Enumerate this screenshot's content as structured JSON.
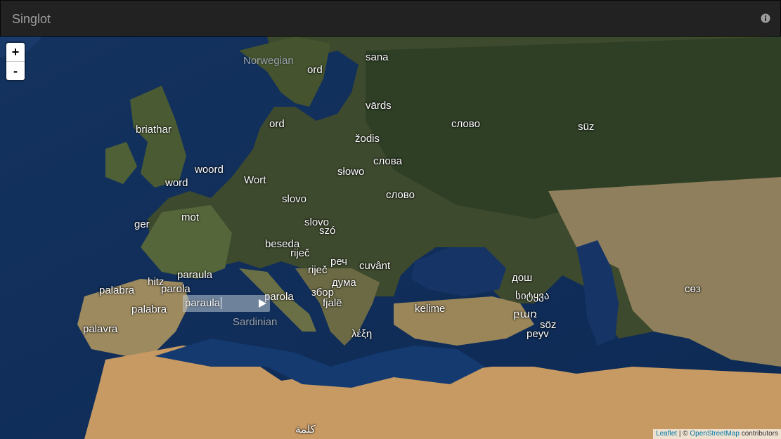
{
  "app": {
    "title": "Singlot",
    "info_icon": "info-circle-icon"
  },
  "zoom": {
    "in_label": "+",
    "out_label": "-"
  },
  "editor": {
    "value": "paraula",
    "submit_icon": "play-icon"
  },
  "region_labels": [
    {
      "key": "norwegian",
      "text": "Norwegian"
    },
    {
      "key": "sardinian",
      "text": "Sardinian"
    }
  ],
  "words": [
    {
      "key": "sana",
      "text": "sana"
    },
    {
      "key": "ord_no",
      "text": "ord"
    },
    {
      "key": "vards",
      "text": "vārds"
    },
    {
      "key": "ord_sv",
      "text": "ord"
    },
    {
      "key": "zodis",
      "text": "žodis"
    },
    {
      "key": "slovo_ru",
      "text": "слово"
    },
    {
      "key": "suz",
      "text": "süz"
    },
    {
      "key": "briathar",
      "text": "briathar"
    },
    {
      "key": "slova",
      "text": "слова"
    },
    {
      "key": "woord",
      "text": "woord"
    },
    {
      "key": "slowo",
      "text": "słowo"
    },
    {
      "key": "word",
      "text": "word"
    },
    {
      "key": "wort",
      "text": "Wort"
    },
    {
      "key": "slovo_uk",
      "text": "слово"
    },
    {
      "key": "slovo_cs",
      "text": "slovo"
    },
    {
      "key": "mot",
      "text": "mot"
    },
    {
      "key": "ger",
      "text": "ger"
    },
    {
      "key": "slovo_sk",
      "text": "slovo"
    },
    {
      "key": "szo",
      "text": "szó"
    },
    {
      "key": "beseda",
      "text": "beseda"
    },
    {
      "key": "rijec1",
      "text": "riječ"
    },
    {
      "key": "rech",
      "text": "реч"
    },
    {
      "key": "rijec2",
      "text": "riječ"
    },
    {
      "key": "cuvant",
      "text": "cuvânt"
    },
    {
      "key": "paraula_oc",
      "text": "paraula"
    },
    {
      "key": "hitz",
      "text": "hitz"
    },
    {
      "key": "duma",
      "text": "дума"
    },
    {
      "key": "dosh",
      "text": "дош"
    },
    {
      "key": "palabra1",
      "text": "palabra"
    },
    {
      "key": "parola_fr",
      "text": "parola"
    },
    {
      "key": "parola_it",
      "text": "parola"
    },
    {
      "key": "zbor",
      "text": "збор"
    },
    {
      "key": "sitkva",
      "text": "სიტყვა"
    },
    {
      "key": "soz_kk",
      "text": "сөз"
    },
    {
      "key": "fjale",
      "text": "fjalë"
    },
    {
      "key": "palabra2",
      "text": "palabra"
    },
    {
      "key": "kelime",
      "text": "kelime"
    },
    {
      "key": "bar",
      "text": "բառ"
    },
    {
      "key": "palavra",
      "text": "palavra"
    },
    {
      "key": "soz_az",
      "text": "söz"
    },
    {
      "key": "lexi",
      "text": "λέξη"
    },
    {
      "key": "peyv",
      "text": "peyv"
    },
    {
      "key": "kalima",
      "text": "كلمة"
    }
  ],
  "attribution": {
    "leaflet": "Leaflet",
    "separator": " | © ",
    "osm": "OpenStreetMap",
    "suffix": " contributors"
  }
}
